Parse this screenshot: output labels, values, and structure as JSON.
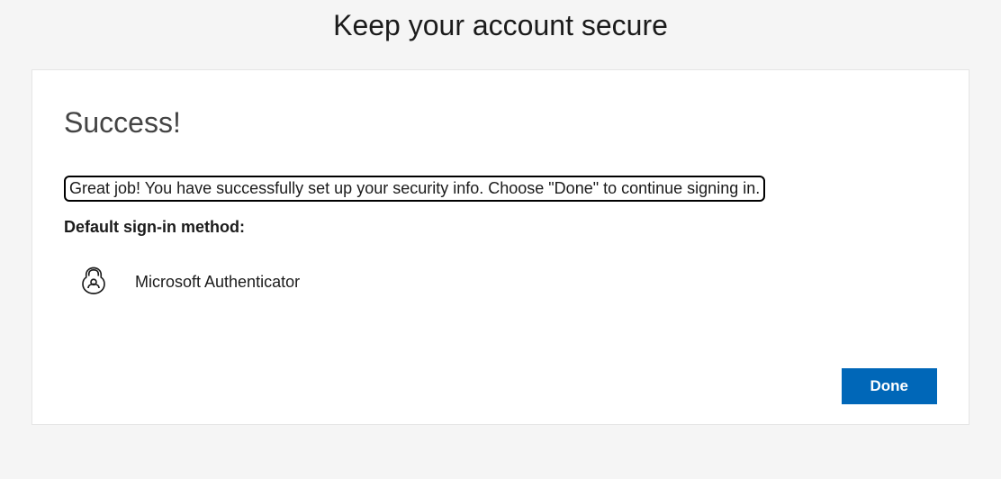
{
  "header": {
    "title": "Keep your account secure"
  },
  "card": {
    "heading": "Success!",
    "message": "Great job! You have successfully set up your security info. Choose \"Done\" to continue signing in.",
    "method_label": "Default sign-in method:",
    "method_name": "Microsoft Authenticator"
  },
  "buttons": {
    "done": "Done"
  }
}
